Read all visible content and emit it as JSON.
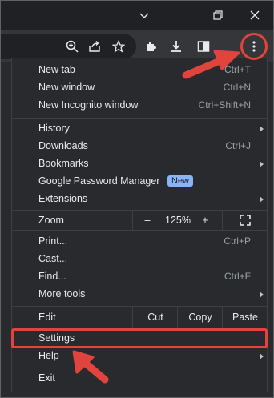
{
  "window": {
    "controls": [
      "chevron-down-icon",
      "restore-icon",
      "close-icon"
    ]
  },
  "toolbar": {
    "icons": [
      "zoom-icon",
      "share-icon",
      "star-icon",
      "extensions-icon",
      "download-icon",
      "sidepanel-icon",
      "menu-dots-icon"
    ]
  },
  "menu": {
    "new_tab": {
      "label": "New tab",
      "shortcut": "Ctrl+T"
    },
    "new_window": {
      "label": "New window",
      "shortcut": "Ctrl+N"
    },
    "new_incognito": {
      "label": "New Incognito window",
      "shortcut": "Ctrl+Shift+N"
    },
    "history": {
      "label": "History"
    },
    "downloads": {
      "label": "Downloads",
      "shortcut": "Ctrl+J"
    },
    "bookmarks": {
      "label": "Bookmarks"
    },
    "password_manager": {
      "label": "Google Password Manager",
      "badge": "New"
    },
    "extensions": {
      "label": "Extensions"
    },
    "zoom": {
      "label": "Zoom",
      "minus": "–",
      "value": "125%",
      "plus": "+"
    },
    "print": {
      "label": "Print...",
      "shortcut": "Ctrl+P"
    },
    "cast": {
      "label": "Cast..."
    },
    "find": {
      "label": "Find...",
      "shortcut": "Ctrl+F"
    },
    "more_tools": {
      "label": "More tools"
    },
    "edit": {
      "label": "Edit",
      "cut": "Cut",
      "copy": "Copy",
      "paste": "Paste"
    },
    "settings": {
      "label": "Settings"
    },
    "help": {
      "label": "Help"
    },
    "exit": {
      "label": "Exit"
    }
  },
  "colors": {
    "accent": "#8ab4f8",
    "annotation": "#e0443c",
    "menu_bg": "#292a2d"
  }
}
